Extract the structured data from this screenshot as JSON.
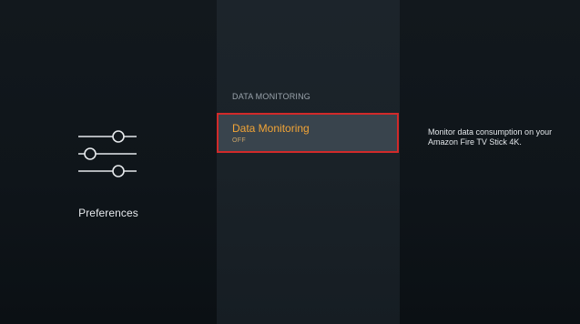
{
  "left_panel": {
    "icon": "preferences-sliders-icon",
    "label": "Preferences"
  },
  "middle_panel": {
    "section_header": "DATA MONITORING",
    "selected_item": {
      "title": "Data Monitoring",
      "value": "OFF"
    }
  },
  "right_panel": {
    "description": "Monitor data consumption on your Amazon Fire TV Stick 4K."
  },
  "colors": {
    "accent": "#f2a436",
    "focus_border": "#d12a2a"
  }
}
